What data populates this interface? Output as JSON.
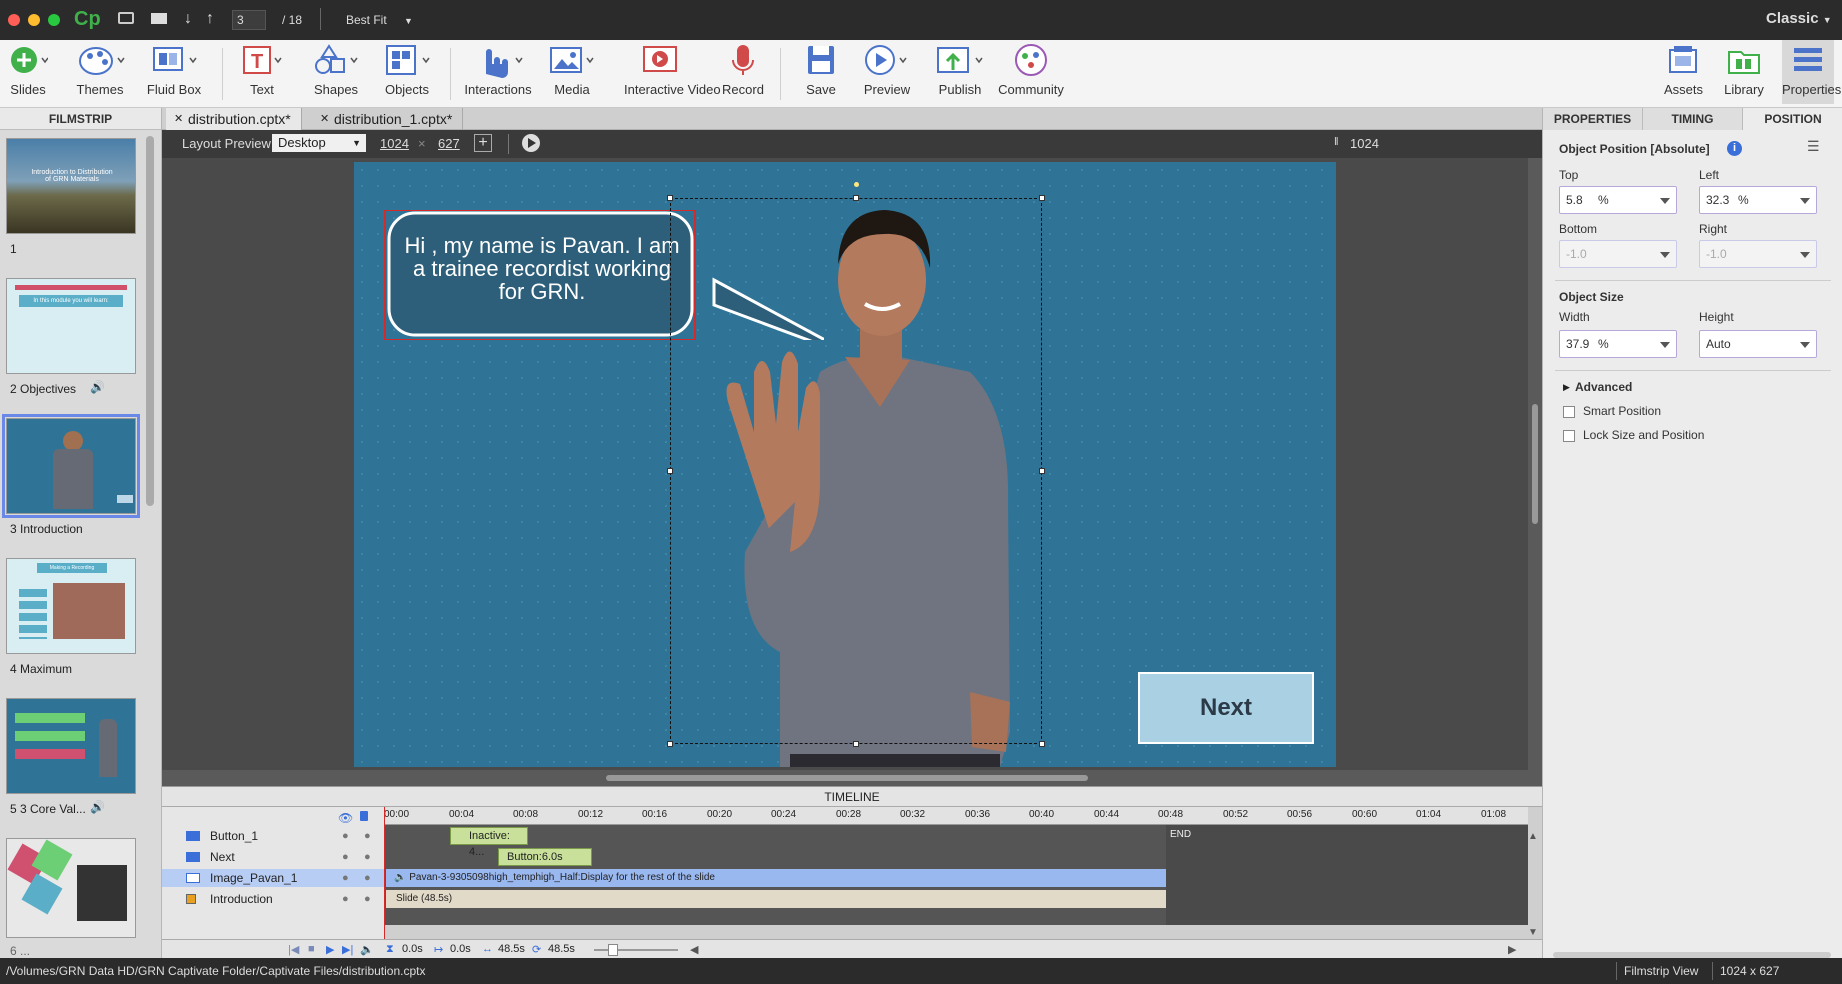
{
  "titlebar": {
    "app_logo": "Cp",
    "page_current": "3",
    "page_total": "/ 18",
    "zoom": "Best Fit",
    "workspace": "Classic"
  },
  "toolbar": {
    "slides": "Slides",
    "themes": "Themes",
    "fluid_box": "Fluid Box",
    "text": "Text",
    "shapes": "Shapes",
    "objects": "Objects",
    "interactions": "Interactions",
    "media": "Media",
    "interactive_video": "Interactive Video",
    "record": "Record",
    "save": "Save",
    "preview": "Preview",
    "publish": "Publish",
    "community": "Community",
    "assets": "Assets",
    "library": "Library",
    "properties": "Properties"
  },
  "filmstrip": {
    "header": "FILMSTRIP",
    "slides": [
      {
        "label": "1",
        "thumb_title": "Introduction to Distribution of GRN Materials"
      },
      {
        "label": "2 Objectives",
        "thumb_title": "In this module you will learn:",
        "audio": true
      },
      {
        "label": "3 Introduction",
        "selected": true
      },
      {
        "label": "4 Maximum",
        "thumb_title": "Making a Recording"
      },
      {
        "label": "5 3 Core Val...",
        "audio": true
      },
      {
        "label": "6 ..."
      }
    ]
  },
  "tabs": [
    "distribution.cptx*",
    "distribution_1.cptx*"
  ],
  "layout_bar": {
    "label": "Layout Preview",
    "device": "Desktop",
    "width": "1024",
    "sep": "×",
    "height": "627",
    "ruler_width": "1024"
  },
  "slide": {
    "bubble_text": "Hi , my name is Pavan. I am a trainee recordist working for GRN.",
    "next_button": "Next"
  },
  "timeline": {
    "title": "TIMELINE",
    "ruler": [
      "00:00",
      "00:04",
      "00:08",
      "00:12",
      "00:16",
      "00:20",
      "00:24",
      "00:28",
      "00:32",
      "00:36",
      "00:40",
      "00:44",
      "00:48",
      "00:52",
      "00:56",
      "00:60",
      "01:04",
      "01:08"
    ],
    "end_label": "END",
    "tracks": [
      {
        "name": "Button_1",
        "bar": "Inactive: 4..."
      },
      {
        "name": "Next",
        "bar": "Button:6.0s"
      },
      {
        "name": "Image_Pavan_1",
        "bar": "Pavan-3-9305098high_temphigh_Half:Display for the rest of the slide"
      },
      {
        "name": "Introduction",
        "bar": "Slide (48.5s)"
      }
    ],
    "footer": {
      "t1": "0.0s",
      "t2": "0.0s",
      "t3": "48.5s",
      "t4": "48.5s"
    }
  },
  "properties": {
    "tabs": [
      "PROPERTIES",
      "TIMING",
      "POSITION"
    ],
    "section_title": "Object Position [Absolute]",
    "top_label": "Top",
    "top_value": "5.8",
    "top_unit": "%",
    "left_label": "Left",
    "left_value": "32.3",
    "left_unit": "%",
    "bottom_label": "Bottom",
    "bottom_value": "-1.0",
    "right_label": "Right",
    "right_value": "-1.0",
    "size_title": "Object Size",
    "width_label": "Width",
    "width_value": "37.9",
    "width_unit": "%",
    "height_label": "Height",
    "height_value": "Auto",
    "advanced": "Advanced",
    "smart_position": "Smart Position",
    "lock_size": "Lock Size and Position"
  },
  "statusbar": {
    "path": "/Volumes/GRN Data HD/GRN Captivate Folder/Captivate Files/distribution.cptx",
    "view": "Filmstrip View",
    "dimensions": "1024 x 627"
  },
  "colors": {
    "accent": "#6a88e8",
    "slide_bg": "#2f7496",
    "track_image": "#9ab8f0",
    "track_button": "#bcd88a"
  }
}
